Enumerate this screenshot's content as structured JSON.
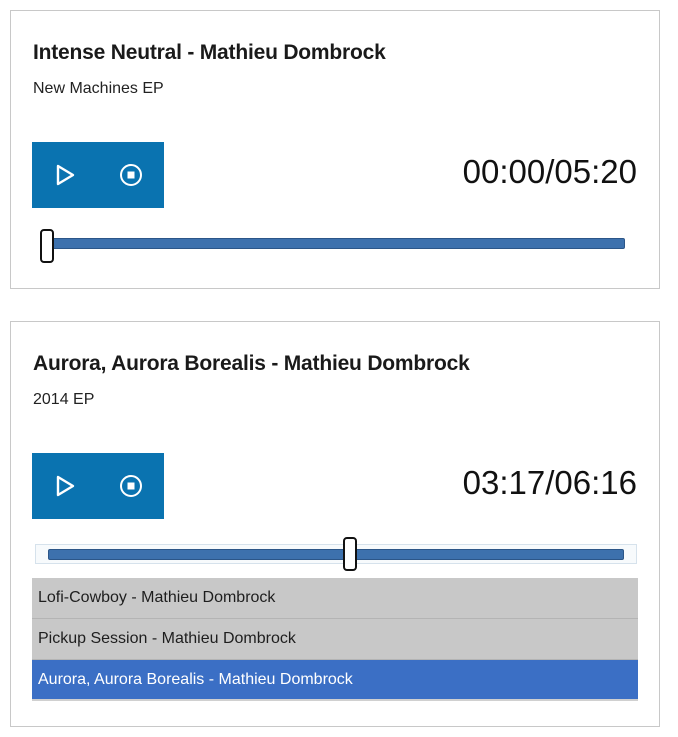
{
  "players": [
    {
      "title": "Intense Neutral - Mathieu Dombrock",
      "album": "New Machines EP",
      "time_display": "00:00/05:20",
      "progress_fraction": 0.0
    },
    {
      "title": "Aurora, Aurora Borealis - Mathieu Dombrock",
      "album": "2014 EP",
      "time_display": "03:17/06:16",
      "progress_fraction": 0.524,
      "playlist": [
        {
          "label": "Lofi-Cowboy - Mathieu Dombrock",
          "active": false
        },
        {
          "label": "Pickup Session - Mathieu Dombrock",
          "active": false
        },
        {
          "label": "Aurora, Aurora Borealis - Mathieu Dombrock",
          "active": true
        }
      ]
    }
  ],
  "icons": {
    "play": "play-icon",
    "stop": "stop-icon"
  },
  "colors": {
    "control_bg": "#0a73b0",
    "track": "#3d71ad",
    "playlist_item_bg": "#c8c8c8",
    "playlist_active_bg": "#3b6fc5"
  }
}
